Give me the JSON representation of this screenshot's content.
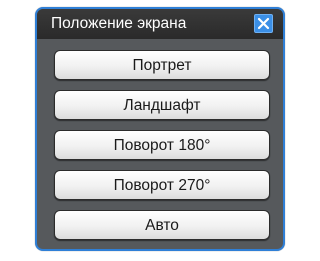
{
  "dialog": {
    "title": "Положение экрана",
    "close_icon": "close-icon",
    "accent_color": "#2f7fd6"
  },
  "options": [
    {
      "label": "Портрет"
    },
    {
      "label": "Ландшафт"
    },
    {
      "label": "Поворот 180°"
    },
    {
      "label": "Поворот 270°"
    },
    {
      "label": "Авто"
    }
  ]
}
